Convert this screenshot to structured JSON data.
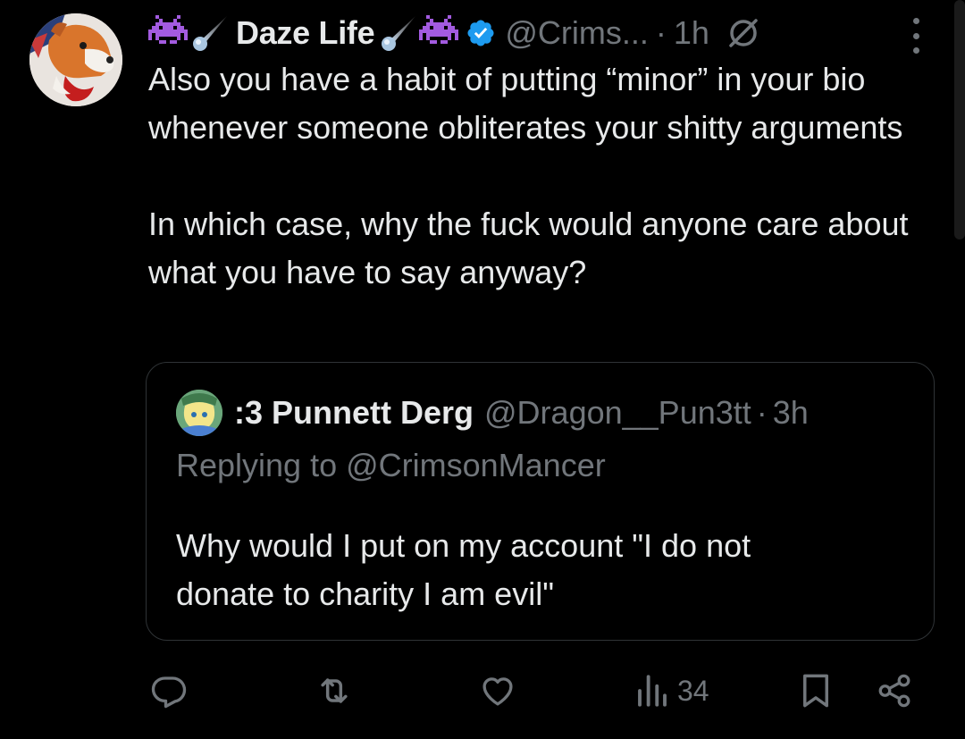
{
  "tweet": {
    "author": {
      "display_name": "Daze Life",
      "handle": "@Crims...",
      "verified": true,
      "name_emojis": [
        "alien-monster-icon",
        "comet-icon"
      ]
    },
    "time": "1h",
    "separator": "·",
    "text_paragraphs": [
      "Also you have a habit of putting “minor” in your bio whenever someone obliterates your shitty arguments",
      "In which case, why the fuck would anyone care about what you have to say anyway?"
    ],
    "quote": {
      "display_name": ":3 Punnett Derg",
      "handle": "@Dragon__Pun3tt",
      "separator": "·",
      "time": "3h",
      "replying_to": "Replying to @CrimsonMancer",
      "text_lines": [
        "Why would I put on my account \"I do not",
        "donate to charity I am evil\""
      ]
    },
    "actions": {
      "reply_count": "",
      "retweet_count": "",
      "like_count": "",
      "views_count": "34"
    }
  },
  "colors": {
    "background": "#000000",
    "text_primary": "#e7e9ea",
    "text_secondary": "#71767b",
    "border": "#2f3336",
    "verified_blue": "#1d9bf0"
  }
}
